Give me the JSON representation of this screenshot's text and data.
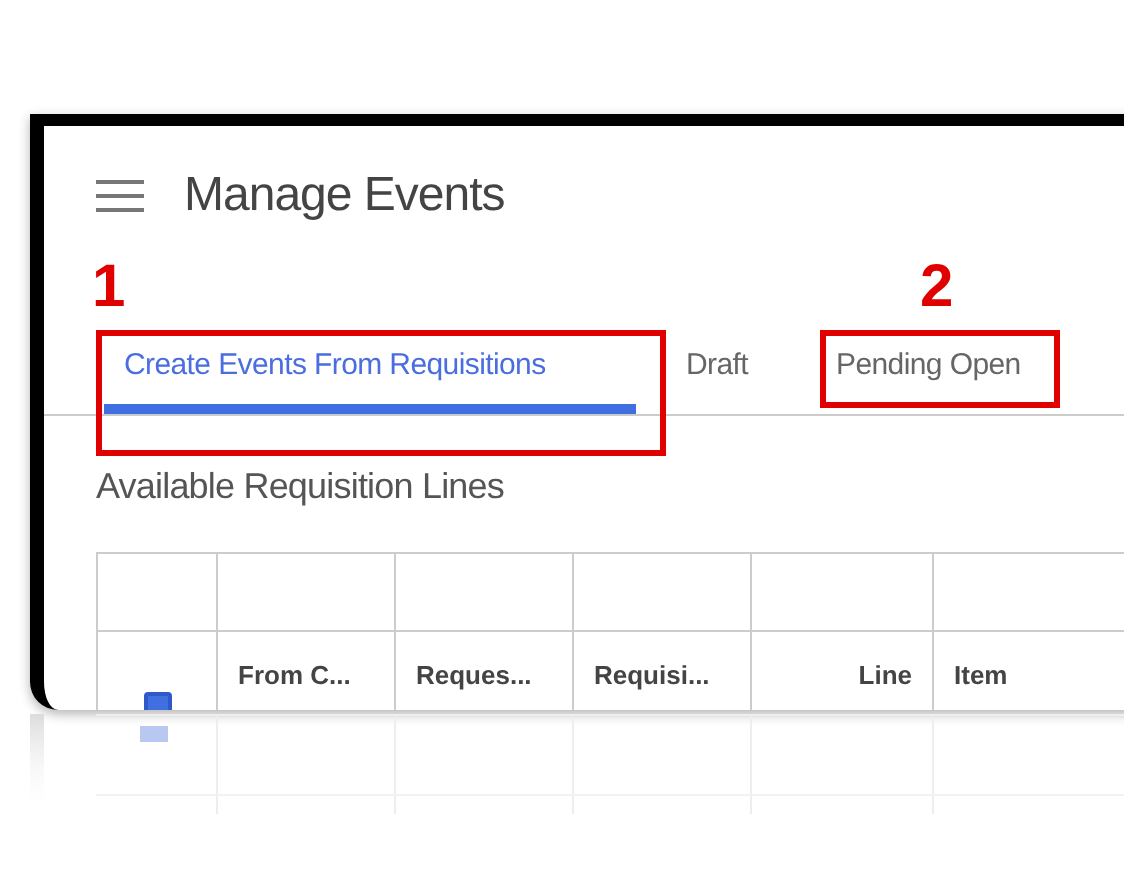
{
  "header": {
    "title": "Manage Events"
  },
  "annotations": [
    {
      "number": "1"
    },
    {
      "number": "2"
    }
  ],
  "tabs": [
    {
      "label": "Create Events From Requisitions",
      "selected": true
    },
    {
      "label": "Draft",
      "selected": false
    },
    {
      "label": "Pending Open",
      "selected": false
    }
  ],
  "section_title": "Available Requisition Lines",
  "table": {
    "select_all": {
      "checked": true
    },
    "columns": [
      {
        "label": "From C..."
      },
      {
        "label": "Reques..."
      },
      {
        "label": "Requisi..."
      },
      {
        "label": "Line"
      },
      {
        "label": "Item"
      }
    ]
  }
}
